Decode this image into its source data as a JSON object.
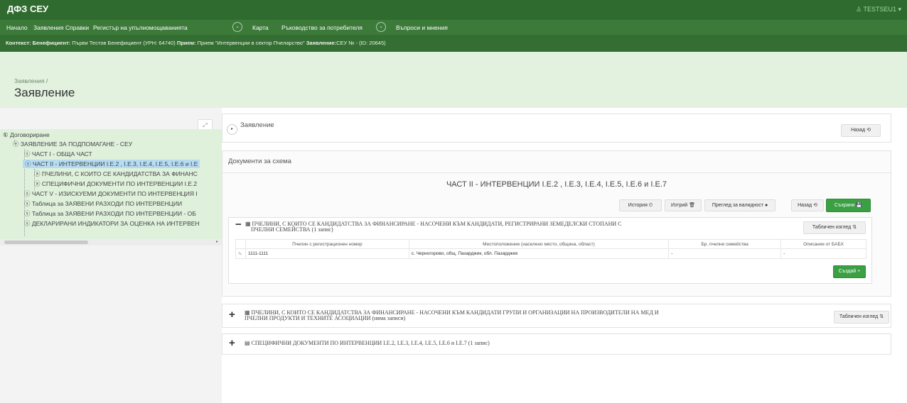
{
  "app": {
    "brand": "ДФЗ СЕУ",
    "user": "♙ TESTSEU1 ▾"
  },
  "nav": {
    "items": [
      "Начало",
      "Заявления",
      "Справки",
      "Регистър на упълномощаванията",
      "Карта",
      "Ръководство за потребителя",
      "Въпроси и мнения"
    ],
    "chevron": "⌄"
  },
  "context": {
    "label1": "Контекст: Бенефициент:",
    "value1": "Първи Тестов Бенефициент (УРН: 64740)",
    "label2": "Прием:",
    "value2": "Прием \"Интервенции в сектор Пчеларство\"",
    "label3": "Заявление:",
    "value3": "СЕУ № - (ID: 20645)"
  },
  "page": {
    "breadcrumb": "Заявления /",
    "title": "Заявление"
  },
  "tree": {
    "expand_icon": "⤢",
    "nodes": [
      "① Договориране",
      "ⓔ ЗАЯВЛЕНИЕ ЗА ПОДПОМАГАНЕ - СЕУ",
      "ⓢ ЧАСТ I - ОБЩА ЧАСТ",
      "ⓢ ЧАСТ II - ИНТЕРВЕНЦИИ I.E.2 , I.E.3, I.E.4, I.E.5, I.E.6 и I.E",
      "ⓐ ПЧЕЛИНИ, С КОИТО СЕ КАНДИДАТСТВА ЗА ФИНАНС",
      "ⓐ СПЕЦИФИЧНИ ДОКУМЕНТИ ПО ИНТЕРВЕНЦИИ I.E.2",
      "ⓢ ЧАСТ V - ИЗИСКУЕМИ ДОКУМЕНТИ ПО ИНТЕРВЕНЦИЯ I",
      "ⓢ Таблица за ЗАЯВЕНИ РАЗХОДИ ПО ИНТЕРВЕНЦИИ",
      "ⓢ Таблица за ЗАЯВЕНИ РАЗХОДИ ПО ИНТЕРВЕНЦИИ - ОБ",
      "ⓢ ДЕКЛАРИРАНИ ИНДИКАТОРИ ЗА ОЦЕНКА НА ИНТЕРВЕН"
    ],
    "scroll_arrow": "▸"
  },
  "top_panel": {
    "title": "Заявление",
    "toggle": "▸",
    "back_label": "Назад ⟲"
  },
  "docs": {
    "header": "Документи за схема",
    "heading": "ЧАСТ II - ИНТЕРВЕНЦИИ I.E.2 , I.E.3, I.E.4, I.E.5, I.E.6 и I.E.7",
    "buttons": {
      "history": "История ⏲",
      "delete": "Изтрий 🗑",
      "validity": "Преглед за валидност ●",
      "back": "Назад ⟲",
      "save": "Съхрани 💾"
    }
  },
  "section1": {
    "toggle": "−",
    "title_line1": "▦ ПЧЕЛИНИ, С КОИТО СЕ КАНДИДАТСТВА ЗА ФИНАНСИРАНЕ - НАСОЧЕНИ КЪМ КАНДИДАТИ, РЕГИСТРИРАНИ ЗЕМЕДЕЛСКИ СТОПАНИ С",
    "title_line2": "ПЧЕЛНИ СЕМЕЙСТВА (1 запис)",
    "table_view": "Табличен изглед ⇅",
    "columns": [
      "",
      "Пчелин с регистрационен номер",
      "Местоположение (населено място, община, област)",
      "Бр. пчелни семейства",
      "Описание от БАБХ"
    ],
    "rows": [
      {
        "edit": "✎",
        "reg": "1111-1111",
        "location": "с. Черногорово, общ. Пазарджик, обл. Пазарджик",
        "families": "-",
        "desc": "-"
      }
    ],
    "create_label": "Създай +"
  },
  "section2": {
    "toggle": "+",
    "title_line1": "▦ ПЧЕЛИНИ, С КОИТО СЕ КАНДИДАТСТВА ЗА ФИНАНСИРАНЕ - НАСОЧЕНИ КЪМ КАНДИДАТИ ГРУПИ И ОРГАНИЗАЦИИ НА ПРОИЗВОДИТЕЛИ НА МЕД И",
    "title_line2": "ПЧЕЛНИ ПРОДУКТИ И ТЕХНИТЕ АСОЦИАЦИИ (няма записи)",
    "table_view": "Табличен изглед ⇅"
  },
  "section3": {
    "toggle": "+",
    "title": "▤ СПЕЦИФИЧНИ ДОКУМЕНТИ ПО ИНТЕРВЕНЦИИ I.E.2, I.E.3, I.E.4, I.E.5, I.E.6 и I.E.7 (1 запис)"
  }
}
